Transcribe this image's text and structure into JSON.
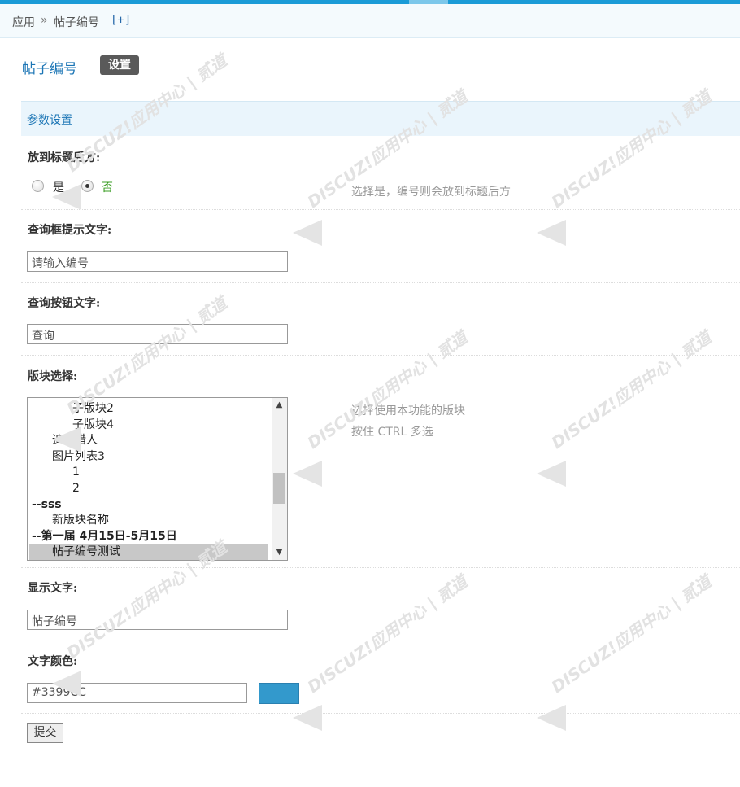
{
  "breadcrumb": {
    "root": "应用",
    "separator": "»",
    "current": "帖子编号",
    "add": "[+]"
  },
  "page": {
    "title": "帖子编号",
    "tab_label": "设置"
  },
  "section": {
    "title": "参数设置"
  },
  "fields": {
    "position": {
      "label": "放到标题后方:",
      "option_yes": "是",
      "option_no": "否",
      "selected": "否",
      "tip": "选择是，编号则会放到标题后方"
    },
    "search_placeholder": {
      "label": "查询框提示文字:",
      "value": "请输入编号"
    },
    "search_button_text": {
      "label": "查询按钮文字:",
      "value": "查询"
    },
    "forums": {
      "label": "版块选择:",
      "tip_line1": "选择使用本功能的版块",
      "tip_line2": "按住 CTRL 多选",
      "options": [
        {
          "text": "子版块2",
          "indent": 2,
          "bold": false,
          "selected": false
        },
        {
          "text": "子版块4",
          "indent": 2,
          "bold": false,
          "selected": false
        },
        {
          "text": "追梦猎人",
          "indent": 1,
          "bold": false,
          "selected": false
        },
        {
          "text": "图片列表3",
          "indent": 1,
          "bold": false,
          "selected": false
        },
        {
          "text": "1",
          "indent": 2,
          "bold": false,
          "selected": false
        },
        {
          "text": "2",
          "indent": 2,
          "bold": false,
          "selected": false
        },
        {
          "text": "--sss",
          "indent": 0,
          "bold": true,
          "selected": false
        },
        {
          "text": "新版块名称",
          "indent": 1,
          "bold": false,
          "selected": false
        },
        {
          "text": "--第一届 4月15日-5月15日",
          "indent": 0,
          "bold": true,
          "selected": false
        },
        {
          "text": "帖子编号测试",
          "indent": 1,
          "bold": false,
          "selected": true
        }
      ]
    },
    "display_text": {
      "label": "显示文字:",
      "value": "帖子编号"
    },
    "text_color": {
      "label": "文字颜色:",
      "value": "#3399CC",
      "swatch": "#3399cc"
    }
  },
  "submit_label": "提交",
  "watermark": {
    "text": "DISCUZ!应用中心 | 贰道"
  },
  "colors": {
    "accent": "#1a9bd7",
    "link": "#1b75b5",
    "section_bg": "#eaf5fc",
    "option_yes_green": "#3a9d23"
  }
}
